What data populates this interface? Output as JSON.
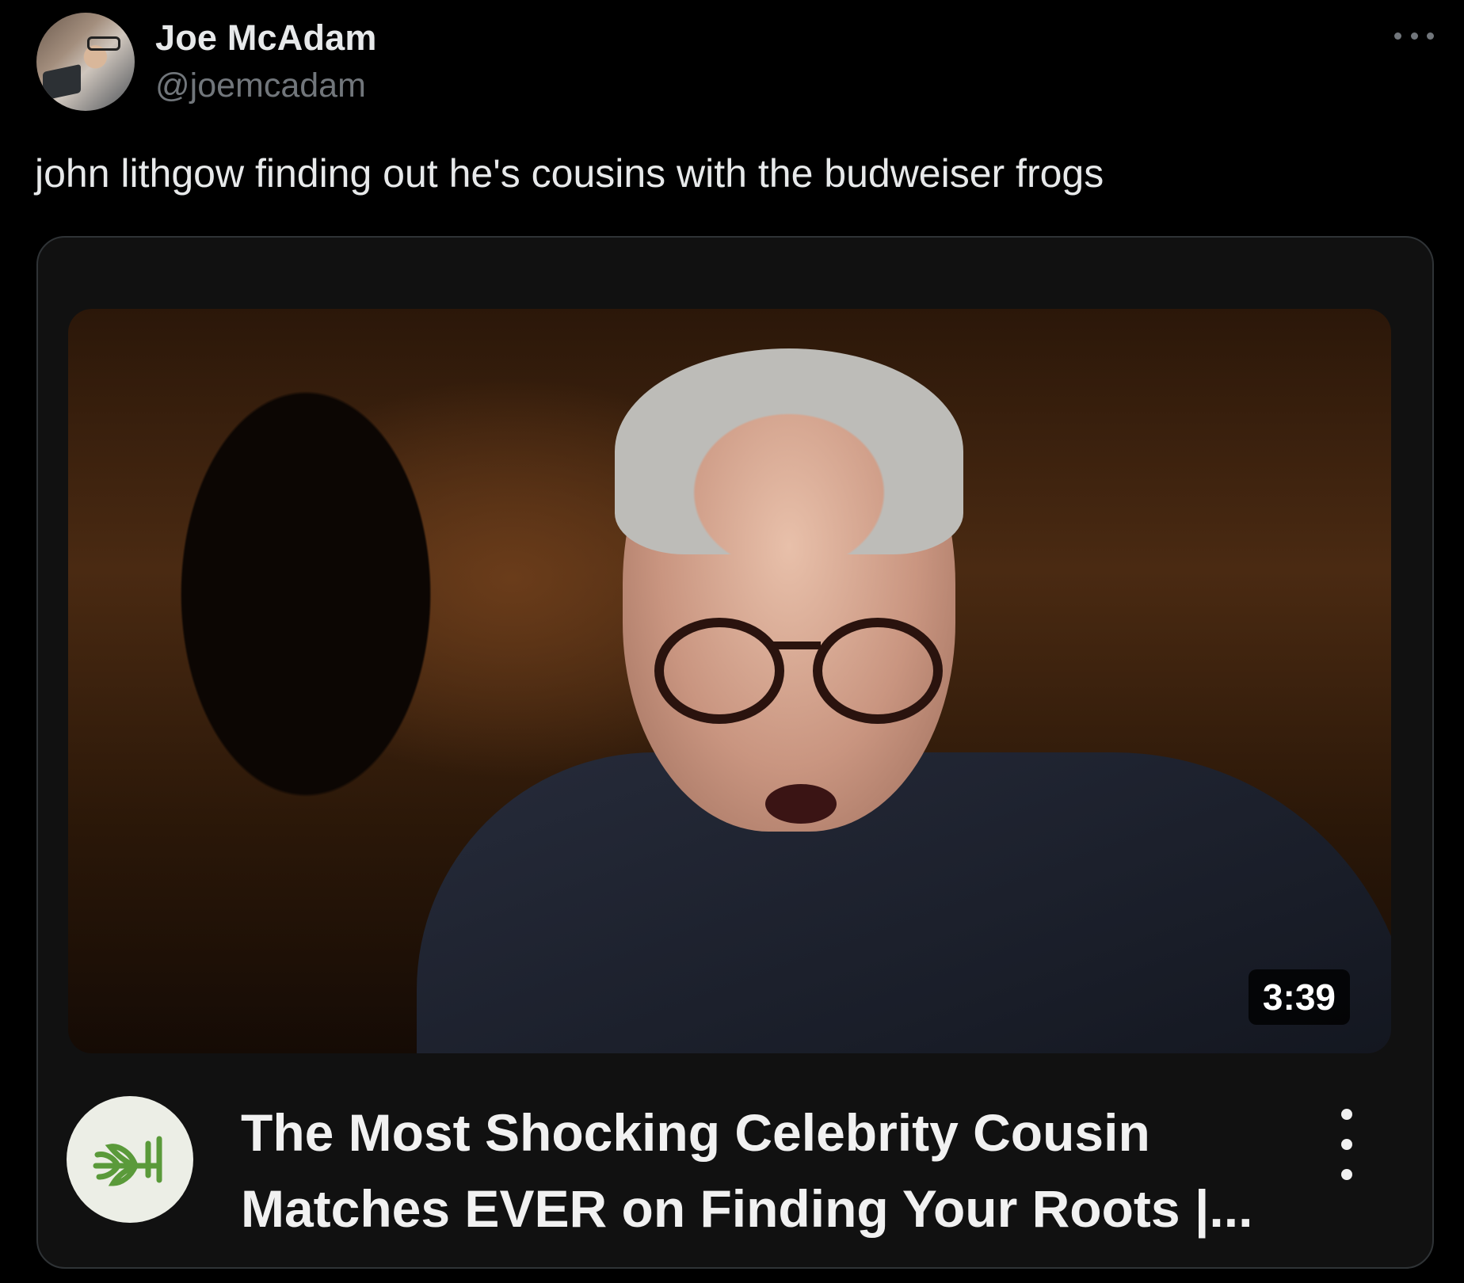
{
  "author": {
    "display_name": "Joe McAdam",
    "handle": "@joemcadam"
  },
  "tweet": {
    "text": "john lithgow finding out he's cousins with the budweiser frogs"
  },
  "video_card": {
    "duration": "3:39",
    "title_line1": "The Most Shocking Celebrity Cousin",
    "title_line2": "Matches EVER on Finding Your Roots |...",
    "channel_logo_icon": "sprout-icon",
    "channel_logo_color": "#5a9a3a"
  },
  "icons": {
    "more_icon": "more-horizontal-icon",
    "video_menu_icon": "more-vertical-icon"
  }
}
